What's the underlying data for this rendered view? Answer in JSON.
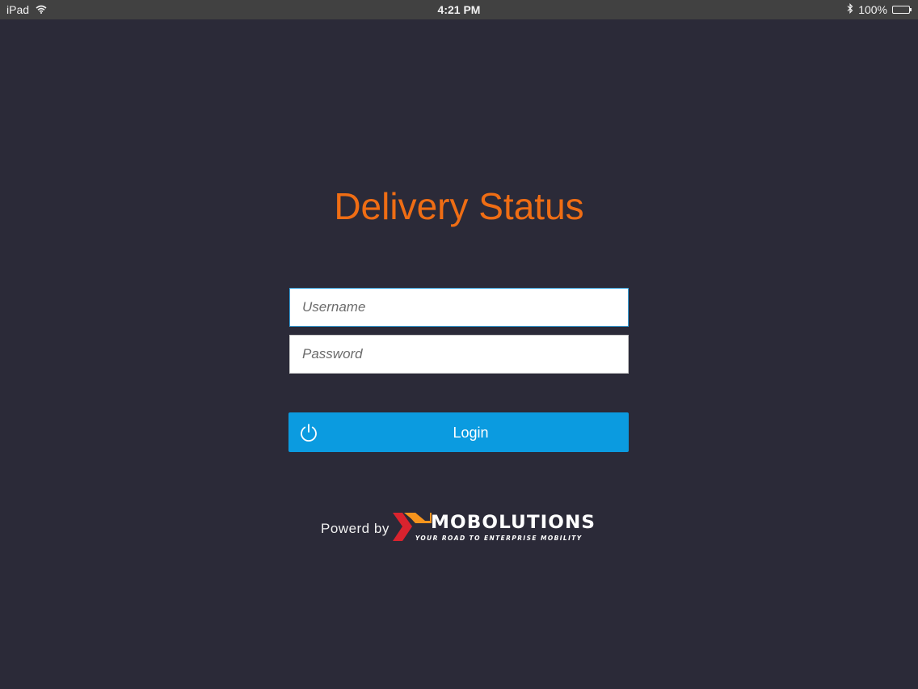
{
  "status_bar": {
    "device": "iPad",
    "time": "4:21 PM",
    "battery": "100%",
    "icons": [
      "wifi-icon",
      "bluetooth-icon",
      "battery-icon"
    ]
  },
  "app": {
    "title": "Delivery Status"
  },
  "form": {
    "username_placeholder": "Username",
    "username_value": "",
    "password_placeholder": "Password",
    "password_value": "",
    "login_label": "Login"
  },
  "footer": {
    "powered_by": "Powerd by",
    "brand": "MOBOLUTIONS",
    "tagline": "YOUR ROAD TO ENTERPRISE MOBILITY"
  },
  "colors": {
    "background": "#2b2a38",
    "title": "#ef6d14",
    "button": "#0b9be0",
    "logo_red": "#d9232e",
    "logo_orange": "#f7941d"
  }
}
